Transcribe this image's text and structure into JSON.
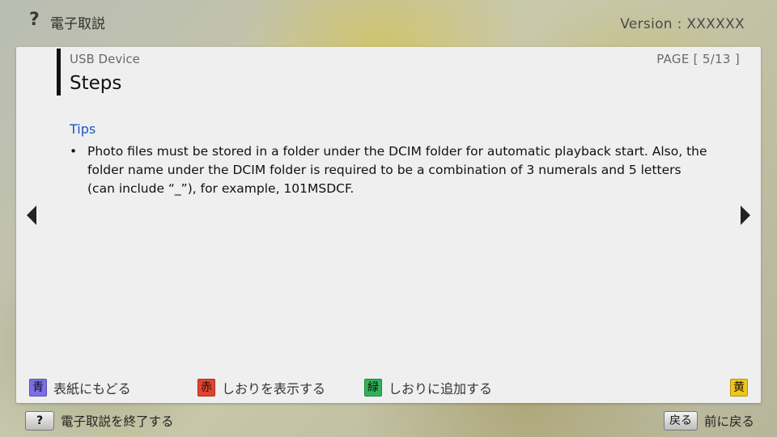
{
  "app": {
    "help_glyph": "?",
    "title": "電子取説",
    "version": "Version : XXXXXX"
  },
  "header": {
    "section": "USB Device",
    "page_indicator": "PAGE [ 5/13 ]",
    "title": "Steps"
  },
  "content": {
    "tips_heading": "Tips",
    "tips": [
      {
        "bullet": "•",
        "text": "Photo files must be stored in a folder under the DCIM folder for automatic playback start. Also, the folder name under the DCIM folder is required to be a combination of 3 numerals and 5 letters (can include “_”), for example, 101MSDCF."
      }
    ]
  },
  "nav": {
    "prev_icon": "triangle-left",
    "next_icon": "triangle-right"
  },
  "color_keys": {
    "blue": {
      "chip": "青",
      "label": "表紙にもどる",
      "color": "#7b6ee8"
    },
    "red": {
      "chip": "赤",
      "label": "しおりを表示する",
      "color": "#e0442f"
    },
    "green": {
      "chip": "緑",
      "label": "しおりに追加する",
      "color": "#2fb25a"
    },
    "yellow": {
      "chip": "黄",
      "color": "#f0c419"
    }
  },
  "footer": {
    "exit_key": "?",
    "exit_label": "電子取説を終了する",
    "back_key": "戻る",
    "back_label": "前に戻る"
  },
  "colors": {
    "accent_blue": "#1a55c9",
    "panel_bg": "#efefef"
  }
}
